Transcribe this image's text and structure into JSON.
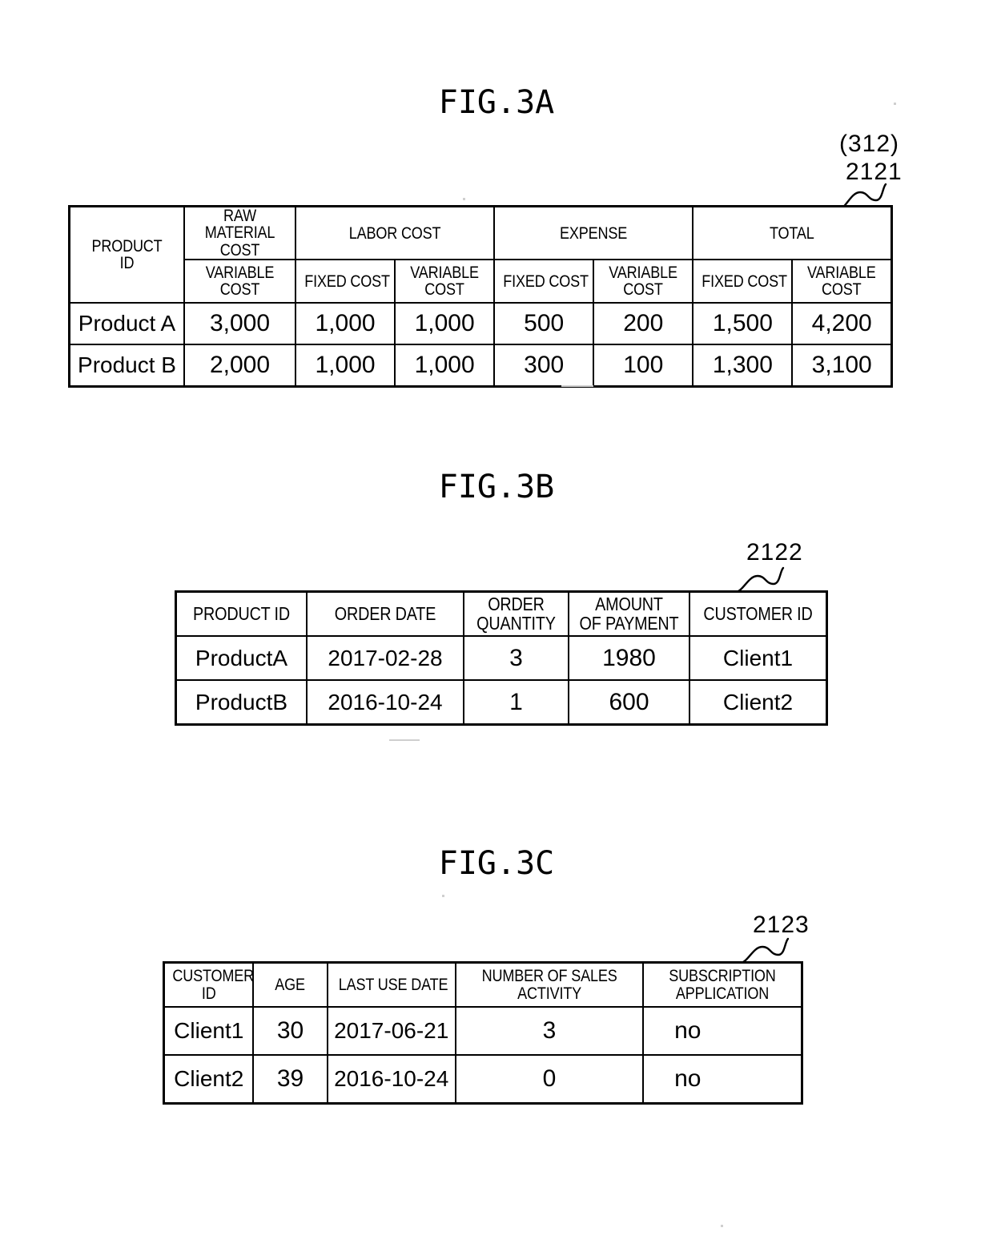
{
  "figures": [
    {
      "title": "FIG.3A",
      "ref_paren": "(312)",
      "ref_number": "2121",
      "table": {
        "header_groups": [
          {
            "label": "PRODUCT\nID",
            "span": 1,
            "rowspan": 2
          },
          {
            "label": "RAW MATERIAL COST",
            "span": 1
          },
          {
            "label": "LABOR COST",
            "span": 2
          },
          {
            "label": "EXPENSE",
            "span": 2
          },
          {
            "label": "TOTAL",
            "span": 2
          }
        ],
        "header_top": {
          "product_id": "PRODUCT ID",
          "product_id_l1": "PRODUCT",
          "product_id_l2": "ID",
          "raw_material_l1": "RAW MATERIAL",
          "raw_material_l2": "COST",
          "labor_cost": "LABOR COST",
          "expense": "EXPENSE",
          "total": "TOTAL"
        },
        "header_bottom": {
          "raw_variable_l1": "VARIABLE",
          "raw_variable_l2": "COST",
          "labor_fixed": "FIXED COST",
          "labor_variable_l1": "VARIABLE",
          "labor_variable_l2": "COST",
          "expense_fixed": "FIXED COST",
          "expense_variable_l1": "VARIABLE",
          "expense_variable_l2": "COST",
          "total_fixed": "FIXED COST",
          "total_variable_l1": "VARIABLE",
          "total_variable_l2": "COST"
        },
        "rows": [
          {
            "product_id": "Product A",
            "raw_material_variable": "3,000",
            "labor_fixed": "1,000",
            "labor_variable": "1,000",
            "expense_fixed": "500",
            "expense_variable": "200",
            "total_fixed": "1,500",
            "total_variable": "4,200"
          },
          {
            "product_id": "Product B",
            "raw_material_variable": "2,000",
            "labor_fixed": "1,000",
            "labor_variable": "1,000",
            "expense_fixed": "300",
            "expense_variable": "100",
            "total_fixed": "1,300",
            "total_variable": "3,100"
          }
        ]
      }
    },
    {
      "title": "FIG.3B",
      "ref_number": "2122",
      "table": {
        "headers": {
          "product_id": "PRODUCT ID",
          "order_date": "ORDER DATE",
          "order_quantity_l1": "ORDER",
          "order_quantity_l2": "QUANTITY",
          "amount_of_payment_l1": "AMOUNT",
          "amount_of_payment_l2": "OF PAYMENT",
          "customer_id": "CUSTOMER ID"
        },
        "rows": [
          {
            "product_id": "ProductA",
            "order_date": "2017-02-28",
            "order_quantity": "3",
            "amount_of_payment": "1980",
            "customer_id": "Client1"
          },
          {
            "product_id": "ProductB",
            "order_date": "2016-10-24",
            "order_quantity": "1",
            "amount_of_payment": "600",
            "customer_id": "Client2"
          }
        ]
      }
    },
    {
      "title": "FIG.3C",
      "ref_number": "2123",
      "table": {
        "headers": {
          "customer_id_l1": "CUSTOMER",
          "customer_id_l2": "ID",
          "age": "AGE",
          "last_use_date": "LAST USE DATE",
          "number_of_sales_activity_l1": "NUMBER OF SALES",
          "number_of_sales_activity_l2": "ACTIVITY",
          "subscription_application_l1": "SUBSCRIPTION",
          "subscription_application_l2": "APPLICATION"
        },
        "rows": [
          {
            "customer_id": "Client1",
            "age": "30",
            "last_use_date": "2017-06-21",
            "number_of_sales_activity": "3",
            "subscription_application": "no"
          },
          {
            "customer_id": "Client2",
            "age": "39",
            "last_use_date": "2016-10-24",
            "number_of_sales_activity": "0",
            "subscription_application": "no"
          }
        ]
      }
    }
  ],
  "colors": {
    "ink": "#000000",
    "paper": "#ffffff"
  }
}
